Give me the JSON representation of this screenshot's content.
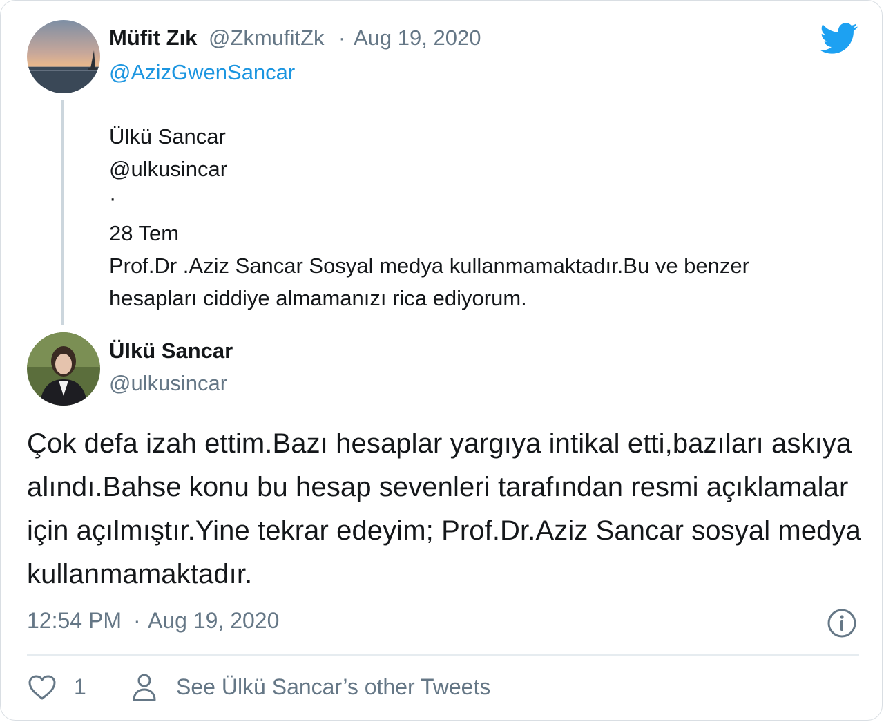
{
  "parent_tweet": {
    "author_name": "Müfit Zık",
    "author_handle": "@ZkmufitZk",
    "separator": "·",
    "date": "Aug 19, 2020",
    "reply_mention": "@AzizGwenSancar",
    "quoted": {
      "name": "Ülkü Sancar",
      "handle": "@ulkusincar",
      "dot": "·",
      "date": "28 Tem",
      "text_line1": "Prof.Dr .Aziz Sancar Sosyal medya kullanmamaktadır.Bu ve benzer",
      "text_line2": "hesapları ciddiye almamanızı rica ediyorum."
    }
  },
  "main_tweet": {
    "author_name": "Ülkü Sancar",
    "author_handle": "@ulkusincar",
    "text": "Çok defa izah ettim.Bazı hesaplar yargıya intikal etti,bazıları askıya alındı.Bahse konu bu hesap sevenleri tarafından resmi açıklamalar için açılmıştır.Yine tekrar edeyim; Prof.Dr.Aziz Sancar sosyal medya kullanmamaktadır.",
    "time": "12:54 PM",
    "separator": "·",
    "date": "Aug 19, 2020"
  },
  "footer": {
    "like_count": "1",
    "other_tweets_label": "See Ülkü Sancar’s other Tweets"
  },
  "icons": {
    "brand": "twitter-bird-icon",
    "info": "info-icon",
    "like": "heart-icon",
    "profile": "person-icon"
  },
  "colors": {
    "brand_blue": "#1da1f2",
    "link_blue": "#1b95e0",
    "muted_gray": "#657786",
    "text": "#14171a"
  }
}
